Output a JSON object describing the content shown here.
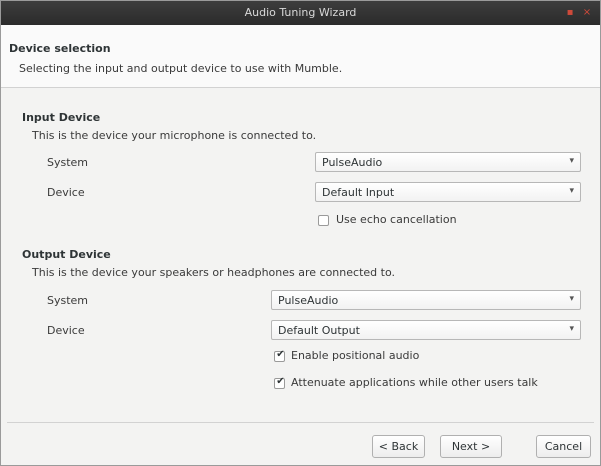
{
  "window": {
    "title": "Audio Tuning Wizard",
    "minimize_glyph": "▪",
    "close_glyph": "×"
  },
  "header": {
    "title": "Device selection",
    "subtitle": "Selecting the input and output device to use with Mumble."
  },
  "input_device": {
    "title": "Input Device",
    "description": "This is the device your microphone is connected to.",
    "system_label": "System",
    "system_value": "PulseAudio",
    "device_label": "Device",
    "device_value": "Default Input",
    "echo_cancel_label": "Use echo cancellation",
    "echo_cancel_checked": false
  },
  "output_device": {
    "title": "Output Device",
    "description": "This is the device your speakers or headphones are connected to.",
    "system_label": "System",
    "system_value": "PulseAudio",
    "device_label": "Device",
    "device_value": "Default Output",
    "positional_label": "Enable positional audio",
    "positional_checked": true,
    "attenuate_label": "Attenuate applications while other users talk",
    "attenuate_checked": true
  },
  "combo_arrow_glyph": "▾",
  "check_glyph": "✔",
  "footer": {
    "back_label": "< Back",
    "next_label": "Next >",
    "cancel_label": "Cancel"
  }
}
